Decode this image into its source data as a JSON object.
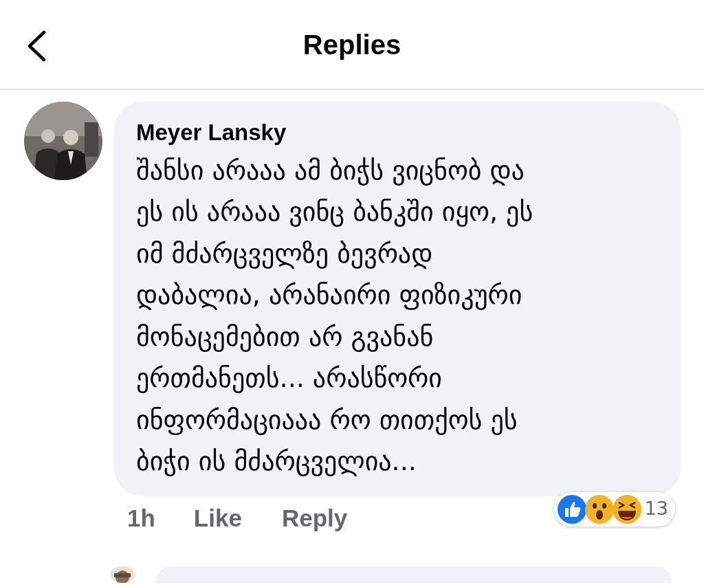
{
  "header": {
    "title": "Replies"
  },
  "comments": [
    {
      "kind": "full",
      "author": "Meyer Lansky",
      "text": "შანსი არააა ამ ბიჭს ვიცნობ და\nეს ის არააა ვინც ბანკში იყო, ეს\nიმ მძარცველზე ბევრად\nდაბალია, არანაირი ფიზიკური\nმონაცემებით არ გვანან\nერთმანეთს... არასწორი\nინფორმაციააა რო თითქოს ეს\nბიჭი ის მძარცველია...",
      "time": "1h",
      "actions": [
        "Like",
        "Reply"
      ],
      "reaction_count": "13"
    },
    {
      "kind": "cut"
    }
  ]
}
